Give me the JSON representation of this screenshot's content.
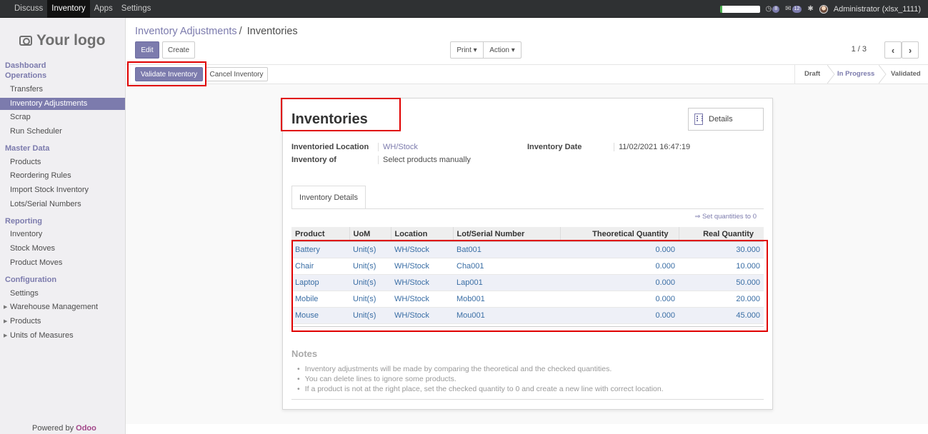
{
  "topbar": {
    "menus": [
      "Discuss",
      "Inventory",
      "Apps",
      "Settings"
    ],
    "badge_chat": "8",
    "badge_msg": "12",
    "user": "Administrator (xlsx_1111)"
  },
  "sidebar": {
    "logo": "Your logo",
    "sections": [
      {
        "title": "Dashboard Operations",
        "items": [
          "Transfers",
          "Inventory Adjustments",
          "Scrap",
          "Run Scheduler"
        ]
      },
      {
        "title": "Master Data",
        "items": [
          "Products",
          "Reordering Rules",
          "Import Stock Inventory",
          "Lots/Serial Numbers"
        ]
      },
      {
        "title": "Reporting",
        "items": [
          "Inventory",
          "Stock Moves",
          "Product Moves"
        ]
      },
      {
        "title": "Configuration",
        "items": [
          "Settings",
          "Warehouse Management",
          "Products",
          "Units of Measures"
        ]
      }
    ],
    "dashboard_line1": "Dashboard",
    "dashboard_line2": "Operations",
    "powered_prefix": "Powered by",
    "powered_brand": "Odoo"
  },
  "breadcrumb": {
    "parent": "Inventory Adjustments",
    "sep": "/",
    "current": "Inventories"
  },
  "toolbar": {
    "edit": "Edit",
    "create": "Create",
    "print": "Print",
    "action": "Action",
    "pager": "1 / 3"
  },
  "buttons": {
    "validate": "Validate Inventory",
    "cancel": "Cancel Inventory"
  },
  "stages": [
    "Draft",
    "In Progress",
    "Validated"
  ],
  "form": {
    "title": "Inventories",
    "details": "Details",
    "location_label": "Inventoried Location",
    "location_value": "WH/Stock",
    "inventory_of_label": "Inventory of",
    "inventory_of_value": "Select products manually",
    "date_label": "Inventory Date",
    "date_value": "11/02/2021 16:47:19",
    "tab": "Inventory Details",
    "set_quantities": "⇒ Set quantities to 0",
    "columns": [
      "Product",
      "UoM",
      "Location",
      "Lot/Serial Number",
      "Theoretical Quantity",
      "Real Quantity"
    ],
    "rows": [
      [
        "Battery",
        "Unit(s)",
        "WH/Stock",
        "Bat001",
        "0.000",
        "30.000"
      ],
      [
        "Chair",
        "Unit(s)",
        "WH/Stock",
        "Cha001",
        "0.000",
        "10.000"
      ],
      [
        "Laptop",
        "Unit(s)",
        "WH/Stock",
        "Lap001",
        "0.000",
        "50.000"
      ],
      [
        "Mobile",
        "Unit(s)",
        "WH/Stock",
        "Mob001",
        "0.000",
        "20.000"
      ],
      [
        "Mouse",
        "Unit(s)",
        "WH/Stock",
        "Mou001",
        "0.000",
        "45.000"
      ]
    ],
    "notes_title": "Notes",
    "notes": [
      "Inventory adjustments will be made by comparing the theoretical and the checked quantities.",
      "You can delete lines to ignore some products.",
      "If a product is not at the right place, set the checked quantity to 0 and create a new line with correct location."
    ]
  },
  "colors": {
    "accent": "#7c7bad",
    "highlight": "#e00000",
    "navbar": "#2f3133"
  }
}
